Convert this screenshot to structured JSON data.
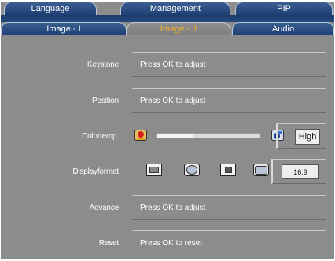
{
  "tabs_top": [
    "Language",
    "Management",
    "PIP"
  ],
  "tabs_bottom": [
    "Image - I",
    "Image - II",
    "Audio"
  ],
  "active_tab": "Image - II",
  "rows": {
    "keystone": {
      "label": "Keystone",
      "value": "Press OK  to adjust"
    },
    "position": {
      "label": "Position",
      "value": "Press OK  to adjust"
    },
    "color_temp": {
      "label": "Colortemp.",
      "value": "High",
      "level": 0.35
    },
    "display_format": {
      "label": "Displayformat",
      "value": "16:9"
    },
    "advance": {
      "label": "Advance",
      "value": "Press OK  to adjust"
    },
    "reset": {
      "label": "Reset",
      "value": "Press OK  to reset"
    }
  },
  "icons": {
    "color_low": "warm-color-icon",
    "color_high": "cool-color-icon",
    "formats": [
      "format-4-3-icon",
      "format-circle-icon",
      "format-small-icon",
      "format-wide-icon"
    ]
  },
  "colors": {
    "osd_bg": "#8c8c8c",
    "tab_blue": "#1d3f73",
    "active_text": "#f0b020"
  }
}
